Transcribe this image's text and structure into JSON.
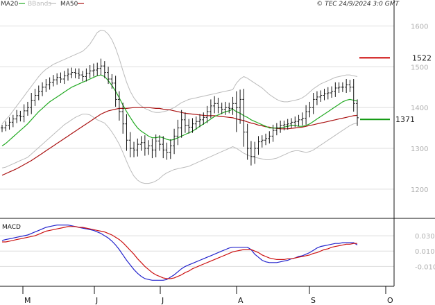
{
  "chart_data": [
    {
      "type": "ohlc",
      "legend": [
        {
          "label": "MA20",
          "color": "#22aa22"
        },
        {
          "label": "BBands",
          "color": "#bbbbbb"
        },
        {
          "label": "MA50",
          "color": "#aa1111"
        }
      ],
      "copyright": "© TEC 24/9/2024 3:0 GMT",
      "ylim": [
        1130,
        1640
      ],
      "yticks": [
        {
          "value": 1200,
          "label": "1200"
        },
        {
          "value": 1300,
          "label": "1300"
        },
        {
          "value": 1400,
          "label": "1400"
        },
        {
          "value": 1500,
          "label": "1500"
        },
        {
          "value": 1600,
          "label": "1600"
        }
      ],
      "xticks": [
        "M",
        "J",
        "J",
        "A",
        "S",
        "O"
      ],
      "levels": [
        {
          "value": 1522,
          "label": "1522",
          "color": "#cc0000"
        },
        {
          "value": 1371,
          "label": "1371",
          "color": "#119911"
        }
      ],
      "close": [
        1350,
        1356,
        1364,
        1372,
        1380,
        1378,
        1392,
        1400,
        1418,
        1430,
        1440,
        1450,
        1456,
        1462,
        1468,
        1474,
        1470,
        1478,
        1482,
        1486,
        1484,
        1480,
        1476,
        1484,
        1490,
        1492,
        1496,
        1502,
        1486,
        1470,
        1460,
        1420,
        1390,
        1360,
        1320,
        1300,
        1296,
        1310,
        1314,
        1300,
        1306,
        1296,
        1318,
        1310,
        1296,
        1290,
        1306,
        1330,
        1350,
        1370,
        1356,
        1352,
        1360,
        1366,
        1370,
        1376,
        1390,
        1404,
        1410,
        1400,
        1396,
        1400,
        1398,
        1410,
        1400,
        1420,
        1340,
        1300,
        1280,
        1300,
        1316,
        1320,
        1324,
        1330,
        1344,
        1350,
        1356,
        1358,
        1360,
        1364,
        1366,
        1370,
        1374,
        1390,
        1400,
        1420,
        1426,
        1430,
        1434,
        1436,
        1440,
        1448,
        1450,
        1450,
        1456,
        1450,
        1410,
        1375
      ],
      "high_offset": [
        8,
        10,
        12,
        10,
        14,
        12,
        16,
        14,
        18,
        16,
        14,
        12,
        14,
        12,
        12,
        10,
        12,
        12,
        14,
        12,
        10,
        12,
        10,
        12,
        14,
        16,
        14,
        18,
        12,
        14,
        12,
        18,
        20,
        22,
        24,
        20,
        16,
        14,
        16,
        18,
        14,
        18,
        16,
        14,
        20,
        18,
        16,
        18,
        20,
        24,
        18,
        16,
        14,
        12,
        14,
        12,
        14,
        16,
        18,
        14,
        12,
        14,
        12,
        16,
        30,
        24,
        26,
        20,
        18,
        16,
        14,
        12,
        12,
        12,
        14,
        12,
        12,
        10,
        12,
        10,
        12,
        12,
        14,
        16,
        14,
        16,
        14,
        12,
        12,
        14,
        12,
        14,
        12,
        12,
        14,
        12,
        20,
        10
      ],
      "low_offset": [
        10,
        8,
        10,
        12,
        10,
        12,
        14,
        12,
        16,
        14,
        12,
        12,
        12,
        12,
        10,
        12,
        10,
        12,
        12,
        10,
        12,
        10,
        12,
        12,
        12,
        14,
        14,
        16,
        14,
        12,
        14,
        18,
        22,
        24,
        26,
        22,
        18,
        16,
        16,
        18,
        16,
        20,
        18,
        16,
        20,
        18,
        16,
        20,
        22,
        24,
        18,
        16,
        14,
        14,
        14,
        12,
        14,
        16,
        18,
        14,
        12,
        14,
        12,
        16,
        60,
        40,
        36,
        28,
        22,
        18,
        16,
        14,
        12,
        12,
        14,
        12,
        12,
        12,
        12,
        10,
        12,
        12,
        14,
        16,
        14,
        16,
        14,
        12,
        12,
        14,
        12,
        14,
        12,
        12,
        14,
        12,
        20,
        20
      ],
      "ma20": [
        1306,
        1312,
        1320,
        1328,
        1336,
        1344,
        1352,
        1360,
        1370,
        1380,
        1390,
        1398,
        1406,
        1414,
        1420,
        1426,
        1432,
        1438,
        1444,
        1450,
        1454,
        1458,
        1462,
        1466,
        1470,
        1474,
        1478,
        1480,
        1476,
        1466,
        1454,
        1440,
        1424,
        1406,
        1390,
        1376,
        1362,
        1350,
        1342,
        1336,
        1330,
        1326,
        1326,
        1328,
        1326,
        1322,
        1320,
        1322,
        1326,
        1330,
        1334,
        1338,
        1342,
        1348,
        1354,
        1360,
        1366,
        1372,
        1378,
        1382,
        1386,
        1390,
        1392,
        1396,
        1390,
        1386,
        1380,
        1376,
        1370,
        1366,
        1362,
        1358,
        1354,
        1350,
        1350,
        1350,
        1350,
        1352,
        1354,
        1356,
        1356,
        1354,
        1354,
        1356,
        1360,
        1366,
        1372,
        1378,
        1384,
        1390,
        1396,
        1402,
        1408,
        1414,
        1418,
        1420,
        1418,
        1416
      ],
      "ma50": [
        1234,
        1238,
        1242,
        1246,
        1250,
        1255,
        1260,
        1265,
        1270,
        1276,
        1282,
        1288,
        1294,
        1300,
        1306,
        1312,
        1318,
        1324,
        1330,
        1336,
        1342,
        1348,
        1354,
        1360,
        1366,
        1372,
        1378,
        1384,
        1388,
        1392,
        1394,
        1396,
        1398,
        1398,
        1398,
        1399,
        1400,
        1400,
        1400,
        1400,
        1400,
        1399,
        1398,
        1398,
        1396,
        1395,
        1394,
        1392,
        1390,
        1388,
        1386,
        1385,
        1384,
        1383,
        1382,
        1381,
        1380,
        1380,
        1380,
        1379,
        1378,
        1377,
        1376,
        1375,
        1372,
        1370,
        1368,
        1365,
        1362,
        1360,
        1357,
        1355,
        1353,
        1352,
        1350,
        1349,
        1348,
        1348,
        1348,
        1349,
        1350,
        1351,
        1352,
        1354,
        1356,
        1358,
        1360,
        1362,
        1364,
        1366,
        1368,
        1370,
        1372,
        1374,
        1376,
        1378,
        1380,
        1381
      ],
      "bb_upper": [
        1360,
        1370,
        1380,
        1392,
        1404,
        1416,
        1428,
        1440,
        1452,
        1464,
        1476,
        1486,
        1494,
        1500,
        1506,
        1510,
        1514,
        1518,
        1522,
        1526,
        1530,
        1534,
        1538,
        1546,
        1556,
        1570,
        1584,
        1590,
        1588,
        1580,
        1566,
        1546,
        1520,
        1490,
        1462,
        1440,
        1424,
        1412,
        1404,
        1398,
        1394,
        1390,
        1388,
        1388,
        1390,
        1392,
        1396,
        1400,
        1406,
        1412,
        1416,
        1420,
        1422,
        1424,
        1426,
        1428,
        1430,
        1432,
        1434,
        1436,
        1438,
        1440,
        1442,
        1444,
        1460,
        1470,
        1476,
        1472,
        1466,
        1460,
        1454,
        1448,
        1440,
        1432,
        1426,
        1420,
        1416,
        1414,
        1414,
        1416,
        1418,
        1420,
        1424,
        1430,
        1438,
        1446,
        1452,
        1458,
        1462,
        1466,
        1470,
        1474,
        1476,
        1478,
        1480,
        1480,
        1478,
        1476
      ],
      "bb_lower": [
        1252,
        1254,
        1258,
        1262,
        1266,
        1270,
        1274,
        1278,
        1286,
        1294,
        1302,
        1310,
        1318,
        1326,
        1334,
        1342,
        1350,
        1358,
        1364,
        1370,
        1376,
        1380,
        1384,
        1384,
        1382,
        1376,
        1370,
        1366,
        1362,
        1352,
        1340,
        1326,
        1310,
        1290,
        1268,
        1248,
        1232,
        1222,
        1216,
        1214,
        1214,
        1216,
        1220,
        1226,
        1234,
        1240,
        1244,
        1248,
        1250,
        1252,
        1254,
        1256,
        1260,
        1264,
        1268,
        1272,
        1276,
        1280,
        1284,
        1288,
        1292,
        1296,
        1300,
        1304,
        1300,
        1294,
        1288,
        1284,
        1280,
        1278,
        1276,
        1274,
        1272,
        1272,
        1274,
        1276,
        1280,
        1284,
        1288,
        1292,
        1294,
        1294,
        1292,
        1290,
        1292,
        1296,
        1302,
        1308,
        1314,
        1320,
        1326,
        1332,
        1338,
        1344,
        1350,
        1356,
        1360,
        1362
      ]
    },
    {
      "type": "line",
      "title": "MACD",
      "ylim": [
        -0.035,
        0.05
      ],
      "yticks": [
        {
          "value": 0.03,
          "label": "0.030"
        },
        {
          "value": 0.01,
          "label": "0.010"
        },
        {
          "value": -0.01,
          "label": "-0.010"
        }
      ],
      "series": [
        {
          "color": "#2222cc",
          "values": [
            0.024,
            0.025,
            0.026,
            0.027,
            0.028,
            0.029,
            0.03,
            0.031,
            0.033,
            0.035,
            0.037,
            0.039,
            0.041,
            0.042,
            0.043,
            0.044,
            0.044,
            0.044,
            0.044,
            0.043,
            0.042,
            0.041,
            0.04,
            0.039,
            0.038,
            0.037,
            0.035,
            0.033,
            0.03,
            0.027,
            0.023,
            0.018,
            0.012,
            0.005,
            -0.002,
            -0.008,
            -0.014,
            -0.019,
            -0.023,
            -0.026,
            -0.027,
            -0.028,
            -0.028,
            -0.028,
            -0.028,
            -0.027,
            -0.024,
            -0.021,
            -0.017,
            -0.013,
            -0.01,
            -0.008,
            -0.006,
            -0.004,
            -0.002,
            0.0,
            0.002,
            0.004,
            0.006,
            0.008,
            0.01,
            0.012,
            0.014,
            0.015,
            0.015,
            0.015,
            0.015,
            0.015,
            0.012,
            0.006,
            0.002,
            -0.002,
            -0.004,
            -0.005,
            -0.005,
            -0.005,
            -0.004,
            -0.003,
            -0.002,
            0.0,
            0.001,
            0.003,
            0.004,
            0.006,
            0.008,
            0.011,
            0.014,
            0.016,
            0.017,
            0.018,
            0.019,
            0.02,
            0.02,
            0.021,
            0.021,
            0.021,
            0.021,
            0.018
          ]
        },
        {
          "color": "#cc1111",
          "values": [
            0.022,
            0.022,
            0.023,
            0.024,
            0.025,
            0.026,
            0.027,
            0.028,
            0.029,
            0.03,
            0.032,
            0.034,
            0.036,
            0.037,
            0.038,
            0.039,
            0.04,
            0.041,
            0.042,
            0.042,
            0.042,
            0.041,
            0.041,
            0.04,
            0.039,
            0.038,
            0.037,
            0.036,
            0.035,
            0.033,
            0.031,
            0.028,
            0.025,
            0.021,
            0.016,
            0.011,
            0.006,
            0.0,
            -0.005,
            -0.01,
            -0.014,
            -0.018,
            -0.021,
            -0.023,
            -0.025,
            -0.026,
            -0.026,
            -0.025,
            -0.023,
            -0.021,
            -0.018,
            -0.016,
            -0.013,
            -0.011,
            -0.009,
            -0.007,
            -0.005,
            -0.003,
            -0.001,
            0.001,
            0.003,
            0.005,
            0.007,
            0.009,
            0.01,
            0.011,
            0.012,
            0.012,
            0.012,
            0.01,
            0.008,
            0.005,
            0.003,
            0.001,
            0.0,
            -0.001,
            -0.001,
            -0.001,
            0.0,
            0.0,
            0.001,
            0.002,
            0.003,
            0.004,
            0.005,
            0.007,
            0.008,
            0.01,
            0.012,
            0.013,
            0.015,
            0.016,
            0.017,
            0.018,
            0.019,
            0.019,
            0.02,
            0.02
          ]
        }
      ]
    }
  ]
}
